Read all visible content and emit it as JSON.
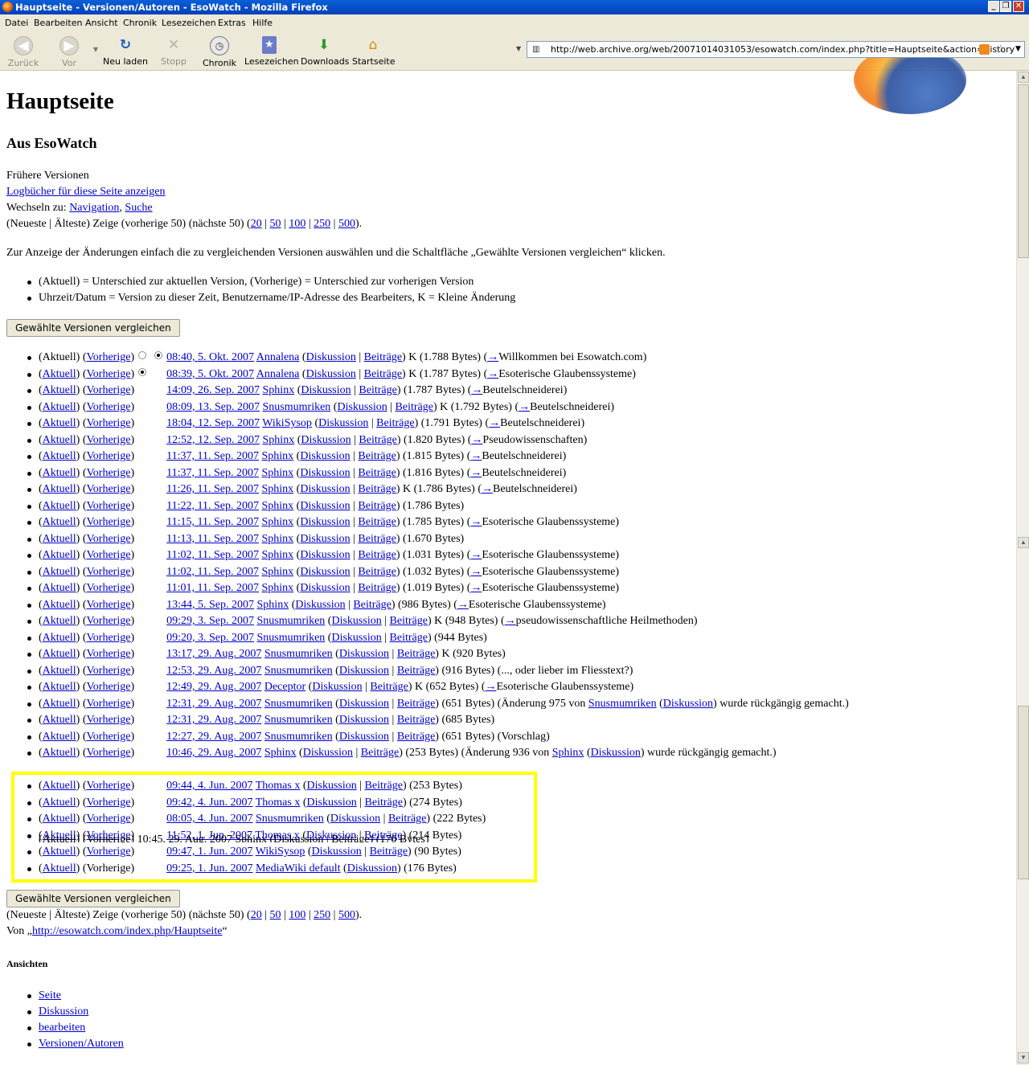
{
  "window": {
    "title": "Hauptseite - Versionen/Autoren - EsoWatch - Mozilla Firefox"
  },
  "menu": [
    "Datei",
    "Bearbeiten",
    "Ansicht",
    "Chronik",
    "Lesezeichen",
    "Extras",
    "Hilfe"
  ],
  "toolbar": {
    "back": "Zurück",
    "forward": "Vor",
    "reload": "Neu laden",
    "stop": "Stopp",
    "history": "Chronik",
    "bookmarks": "Lesezeichen",
    "downloads": "Downloads",
    "home": "Startseite"
  },
  "url": "http://web.archive.org/web/20071014031053/esowatch.com/index.php?title=Hauptseite&action=history",
  "page": {
    "title": "Hauptseite",
    "subtitle": "Aus EsoWatch",
    "history_label": "Frühere Versionen",
    "logs_link": "Logbücher für diese Seite anzeigen",
    "jump_prefix": "Wechseln zu:",
    "jump_nav": "Navigation",
    "jump_sep": ",",
    "jump_search": "Suche",
    "paging_prefix": "(Neueste | Älteste) Zeige (vorherige 50) (nächste 50) (",
    "paging_links": [
      "20",
      "50",
      "100",
      "250",
      "500"
    ],
    "paging_suffix": ").",
    "instructions": "Zur Anzeige der Änderungen einfach die zu vergleichenden Versionen auswählen und die Schaltfläche „Gewählte Versionen vergleichen“ klicken.",
    "legend": [
      "(Aktuell) = Unterschied zur aktuellen Version, (Vorherige) = Unterschied zur vorherigen Version",
      "Uhrzeit/Datum = Version zu dieser Zeit, Benutzername/IP-Adresse des Bearbeiters, K = Kleine Änderung"
    ],
    "compare_button": "Gewählte Versionen vergleichen",
    "cut_row": "(Aktuell) (Vorherige)     10:45, 29. Aug. 2007 Sphinx (Diskussion | Beiträge) (170 Bytes)",
    "source_prefix": "Von „",
    "source_link": "http://esowatch.com/index.php/Hauptseite",
    "source_suffix": "“",
    "views_heading": "Ansichten",
    "views": [
      "Seite",
      "Diskussion",
      "bearbeiten",
      "Versionen/Autoren"
    ]
  },
  "labels": {
    "cur": "Aktuell",
    "prev": "Vorherige",
    "talk": "Diskussion",
    "contribs": "Beiträge"
  },
  "revisions": [
    {
      "curLink": false,
      "prevLink": true,
      "r1": "none",
      "r2": "on",
      "date": "08:40, 5. Okt. 2007",
      "user": "Annalena",
      "contribs": true,
      "minor": true,
      "size": "(1.788 Bytes)",
      "arrow": "→",
      "comment": "Willkommen bei Esowatch.com",
      "userC": null,
      "trail": ""
    },
    {
      "curLink": true,
      "prevLink": true,
      "r1": "on",
      "r2": "off",
      "date": "08:39, 5. Okt. 2007",
      "user": "Annalena",
      "contribs": true,
      "minor": true,
      "size": "(1.787 Bytes)",
      "arrow": "→",
      "comment": "Esoterische Glaubenssysteme",
      "userC": null,
      "trail": ""
    },
    {
      "curLink": true,
      "prevLink": true,
      "r1": "off",
      "r2": "off",
      "date": "14:09, 26. Sep. 2007",
      "user": "Sphinx",
      "contribs": true,
      "minor": false,
      "size": "(1.787 Bytes)",
      "arrow": "→",
      "comment": "Beutelschneiderei",
      "userC": null,
      "trail": ""
    },
    {
      "curLink": true,
      "prevLink": true,
      "r1": "off",
      "r2": "off",
      "date": "08:09, 13. Sep. 2007",
      "user": "Snusmumriken",
      "contribs": true,
      "minor": true,
      "size": "(1.792 Bytes)",
      "arrow": "→",
      "comment": "Beutelschneiderei",
      "userC": null,
      "trail": ""
    },
    {
      "curLink": true,
      "prevLink": true,
      "r1": "off",
      "r2": "off",
      "date": "18:04, 12. Sep. 2007",
      "user": "WikiSysop",
      "contribs": true,
      "minor": false,
      "size": "(1.791 Bytes)",
      "arrow": "→",
      "comment": "Beutelschneiderei",
      "userC": null,
      "trail": ""
    },
    {
      "curLink": true,
      "prevLink": true,
      "r1": "off",
      "r2": "off",
      "date": "12:52, 12. Sep. 2007",
      "user": "Sphinx",
      "contribs": true,
      "minor": false,
      "size": "(1.820 Bytes)",
      "arrow": "→",
      "comment": "Pseudowissenschaften",
      "userC": null,
      "trail": ""
    },
    {
      "curLink": true,
      "prevLink": true,
      "r1": "off",
      "r2": "off",
      "date": "11:37, 11. Sep. 2007",
      "user": "Sphinx",
      "contribs": true,
      "minor": false,
      "size": "(1.815 Bytes)",
      "arrow": "→",
      "comment": "Beutelschneiderei",
      "userC": null,
      "trail": ""
    },
    {
      "curLink": true,
      "prevLink": true,
      "r1": "off",
      "r2": "off",
      "date": "11:37, 11. Sep. 2007",
      "user": "Sphinx",
      "contribs": true,
      "minor": false,
      "size": "(1.816 Bytes)",
      "arrow": "→",
      "comment": "Beutelschneiderei",
      "userC": null,
      "trail": ""
    },
    {
      "curLink": true,
      "prevLink": true,
      "r1": "off",
      "r2": "off",
      "date": "11:26, 11. Sep. 2007",
      "user": "Sphinx",
      "contribs": true,
      "minor": true,
      "size": "(1.786 Bytes)",
      "arrow": "→",
      "comment": "Beutelschneiderei",
      "userC": null,
      "trail": ""
    },
    {
      "curLink": true,
      "prevLink": true,
      "r1": "off",
      "r2": "off",
      "date": "11:22, 11. Sep. 2007",
      "user": "Sphinx",
      "contribs": true,
      "minor": false,
      "size": "(1.786 Bytes)",
      "arrow": "",
      "comment": "",
      "userC": null,
      "trail": ""
    },
    {
      "curLink": true,
      "prevLink": true,
      "r1": "off",
      "r2": "off",
      "date": "11:15, 11. Sep. 2007",
      "user": "Sphinx",
      "contribs": true,
      "minor": false,
      "size": "(1.785 Bytes)",
      "arrow": "→",
      "comment": "Esoterische Glaubenssysteme",
      "userC": null,
      "trail": ""
    },
    {
      "curLink": true,
      "prevLink": true,
      "r1": "off",
      "r2": "off",
      "date": "11:13, 11. Sep. 2007",
      "user": "Sphinx",
      "contribs": true,
      "minor": false,
      "size": "(1.670 Bytes)",
      "arrow": "",
      "comment": "",
      "userC": null,
      "trail": ""
    },
    {
      "curLink": true,
      "prevLink": true,
      "r1": "off",
      "r2": "off",
      "date": "11:02, 11. Sep. 2007",
      "user": "Sphinx",
      "contribs": true,
      "minor": false,
      "size": "(1.031 Bytes)",
      "arrow": "→",
      "comment": "Esoterische Glaubenssysteme",
      "userC": null,
      "trail": ""
    },
    {
      "curLink": true,
      "prevLink": true,
      "r1": "off",
      "r2": "off",
      "date": "11:02, 11. Sep. 2007",
      "user": "Sphinx",
      "contribs": true,
      "minor": false,
      "size": "(1.032 Bytes)",
      "arrow": "→",
      "comment": "Esoterische Glaubenssysteme",
      "userC": null,
      "trail": ""
    },
    {
      "curLink": true,
      "prevLink": true,
      "r1": "off",
      "r2": "off",
      "date": "11:01, 11. Sep. 2007",
      "user": "Sphinx",
      "contribs": true,
      "minor": false,
      "size": "(1.019 Bytes)",
      "arrow": "→",
      "comment": "Esoterische Glaubenssysteme",
      "userC": null,
      "trail": ""
    },
    {
      "curLink": true,
      "prevLink": true,
      "r1": "off",
      "r2": "off",
      "date": "13:44, 5. Sep. 2007",
      "user": "Sphinx",
      "contribs": true,
      "minor": false,
      "size": "(986 Bytes)",
      "arrow": "→",
      "comment": "Esoterische Glaubenssysteme",
      "userC": null,
      "trail": ""
    },
    {
      "curLink": true,
      "prevLink": true,
      "r1": "off",
      "r2": "off",
      "date": "09:29, 3. Sep. 2007",
      "user": "Snusmumriken",
      "contribs": true,
      "minor": true,
      "size": "(948 Bytes)",
      "arrow": "→",
      "comment": "pseudowissenschaftliche Heilmethoden",
      "userC": null,
      "trail": ""
    },
    {
      "curLink": true,
      "prevLink": true,
      "r1": "off",
      "r2": "off",
      "date": "09:20, 3. Sep. 2007",
      "user": "Snusmumriken",
      "contribs": true,
      "minor": false,
      "size": "(944 Bytes)",
      "arrow": "",
      "comment": "",
      "userC": null,
      "trail": ""
    },
    {
      "curLink": true,
      "prevLink": true,
      "r1": "off",
      "r2": "off",
      "date": "13:17, 29. Aug. 2007",
      "user": "Snusmumriken",
      "contribs": true,
      "minor": true,
      "size": "(920 Bytes)",
      "arrow": "",
      "comment": "",
      "userC": null,
      "trail": ""
    },
    {
      "curLink": true,
      "prevLink": true,
      "r1": "off",
      "r2": "off",
      "date": "12:53, 29. Aug. 2007",
      "user": "Snusmumriken",
      "contribs": true,
      "minor": false,
      "size": "(916 Bytes)",
      "arrow": "",
      "comment": "..., oder lieber im Fliesstext?",
      "userC": null,
      "trail": ""
    },
    {
      "curLink": true,
      "prevLink": true,
      "r1": "off",
      "r2": "off",
      "date": "12:49, 29. Aug. 2007",
      "user": "Deceptor",
      "contribs": true,
      "minor": true,
      "size": "(652 Bytes)",
      "arrow": "→",
      "comment": "Esoterische Glaubenssysteme",
      "userC": null,
      "trail": ""
    },
    {
      "curLink": true,
      "prevLink": true,
      "r1": "off",
      "r2": "off",
      "date": "12:31, 29. Aug. 2007",
      "user": "Snusmumriken",
      "contribs": true,
      "minor": false,
      "size": "(651 Bytes)",
      "arrow": "",
      "comment": "Änderung 975 von",
      "userC": "Snusmumriken",
      "trail": "wurde rückgängig gemacht."
    },
    {
      "curLink": true,
      "prevLink": true,
      "r1": "off",
      "r2": "off",
      "date": "12:31, 29. Aug. 2007",
      "user": "Snusmumriken",
      "contribs": true,
      "minor": false,
      "size": "(685 Bytes)",
      "arrow": "",
      "comment": "",
      "userC": null,
      "trail": ""
    },
    {
      "curLink": true,
      "prevLink": true,
      "r1": "off",
      "r2": "off",
      "date": "12:27, 29. Aug. 2007",
      "user": "Snusmumriken",
      "contribs": true,
      "minor": false,
      "size": "(651 Bytes)",
      "arrow": "",
      "comment": "Vorschlag",
      "userC": null,
      "trail": ""
    },
    {
      "curLink": true,
      "prevLink": true,
      "r1": "off",
      "r2": "off",
      "date": "10:46, 29. Aug. 2007",
      "user": "Sphinx",
      "contribs": true,
      "minor": false,
      "size": "(253 Bytes)",
      "arrow": "",
      "comment": "Änderung 936 von",
      "userC": "Sphinx",
      "trail": "wurde rückgängig gemacht."
    },
    {
      "curLink": true,
      "prevLink": true,
      "r1": "off",
      "r2": "off",
      "date": "09:44, 4. Jun. 2007",
      "user": "Thomas x",
      "contribs": true,
      "minor": false,
      "size": "(253 Bytes)",
      "arrow": "",
      "comment": "",
      "userC": null,
      "trail": ""
    },
    {
      "curLink": true,
      "prevLink": true,
      "r1": "off",
      "r2": "off",
      "date": "09:42, 4. Jun. 2007",
      "user": "Thomas x",
      "contribs": true,
      "minor": false,
      "size": "(274 Bytes)",
      "arrow": "",
      "comment": "",
      "userC": null,
      "trail": ""
    },
    {
      "curLink": true,
      "prevLink": true,
      "r1": "off",
      "r2": "off",
      "date": "08:05, 4. Jun. 2007",
      "user": "Snusmumriken",
      "contribs": true,
      "minor": false,
      "size": "(222 Bytes)",
      "arrow": "",
      "comment": "",
      "userC": null,
      "trail": ""
    },
    {
      "curLink": true,
      "prevLink": true,
      "r1": "off",
      "r2": "off",
      "date": "11:52, 1. Jun. 2007",
      "user": "Thomas x",
      "contribs": true,
      "minor": false,
      "size": "(214 Bytes)",
      "arrow": "",
      "comment": "",
      "userC": null,
      "trail": ""
    },
    {
      "curLink": true,
      "prevLink": true,
      "r1": "off",
      "r2": "off",
      "date": "09:47, 1. Jun. 2007",
      "user": "WikiSysop",
      "contribs": true,
      "minor": false,
      "size": "(90 Bytes)",
      "arrow": "",
      "comment": "",
      "userC": null,
      "trail": ""
    },
    {
      "curLink": true,
      "prevLink": false,
      "r1": "off",
      "r2": "off",
      "date": "09:25, 1. Jun. 2007",
      "user": "MediaWiki default",
      "contribs": false,
      "minor": false,
      "size": "(176 Bytes)",
      "arrow": "",
      "comment": "",
      "userC": null,
      "trail": ""
    }
  ]
}
